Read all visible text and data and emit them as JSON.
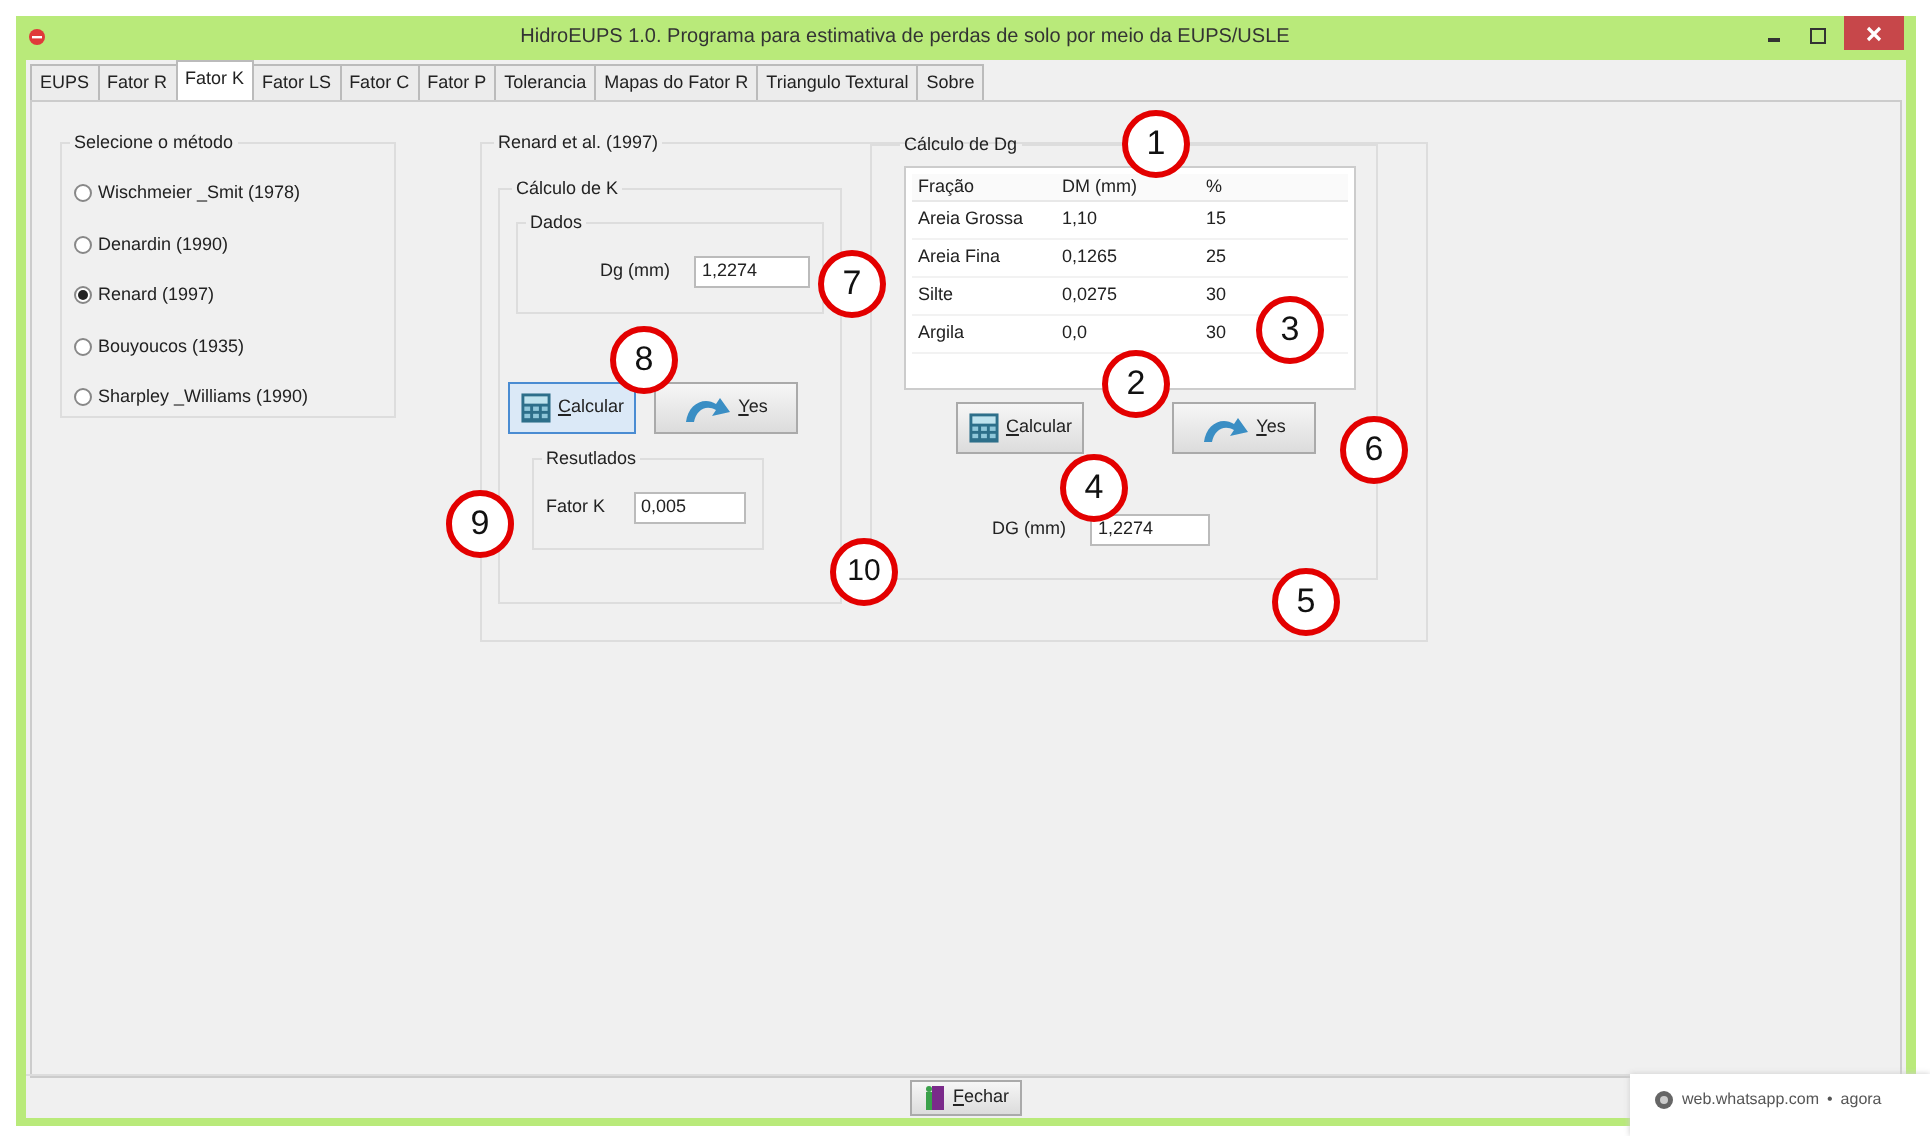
{
  "window": {
    "title": "HidroEUPS 1.0.  Programa para estimativa de perdas de solo por meio da EUPS/USLE"
  },
  "tabs": [
    {
      "label": "EUPS",
      "selected": false
    },
    {
      "label": "Fator R",
      "selected": false
    },
    {
      "label": "Fator K",
      "selected": true
    },
    {
      "label": "Fator LS",
      "selected": false
    },
    {
      "label": "Fator C",
      "selected": false
    },
    {
      "label": "Fator P",
      "selected": false
    },
    {
      "label": "Tolerancia",
      "selected": false
    },
    {
      "label": "Mapas do Fator R",
      "selected": false
    },
    {
      "label": "Triangulo Textural",
      "selected": false
    },
    {
      "label": "Sobre",
      "selected": false
    }
  ],
  "method_group": {
    "title": "Selecione o método",
    "options": [
      {
        "label": "Wischmeier _Smit (1978)",
        "selected": false
      },
      {
        "label": "Denardin (1990)",
        "selected": false
      },
      {
        "label": "Renard (1997)",
        "selected": true
      },
      {
        "label": "Bouyoucos  (1935)",
        "selected": false
      },
      {
        "label": "Sharpley _Williams (1990)",
        "selected": false
      }
    ]
  },
  "renard": {
    "title": "Renard et al.  (1997)",
    "k_calc": {
      "title": "Cálculo de K",
      "data": {
        "title": "Dados",
        "label": "Dg (mm)",
        "value": "1,2274"
      },
      "buttons": [
        {
          "kind": "calc",
          "label": "Calcular",
          "focused": true
        },
        {
          "kind": "yes",
          "label": "Yes",
          "focused": false
        }
      ],
      "results": {
        "title": "Resutlados",
        "label": "Fator K",
        "value": "0,005"
      }
    },
    "dg_calc": {
      "title": "Cálculo de Dg",
      "table": {
        "columns": [
          "Fração",
          "DM (mm)",
          "%"
        ],
        "rows": [
          [
            "Areia Grossa",
            "1,10",
            "15"
          ],
          [
            "Areia Fina",
            "0,1265",
            "25"
          ],
          [
            "Silte",
            "0,0275",
            "30"
          ],
          [
            "Argila",
            "0,0",
            "30"
          ]
        ]
      },
      "buttons": [
        {
          "kind": "calc",
          "label": "Calcular",
          "focused": false
        },
        {
          "kind": "yes",
          "label": "Yes",
          "focused": false
        }
      ],
      "dg": {
        "label": "DG (mm)",
        "value": "1,2274"
      }
    }
  },
  "callouts": [
    "1",
    "2",
    "3",
    "4",
    "5",
    "6",
    "7",
    "8",
    "9",
    "10"
  ],
  "footer": {
    "close_button": "Fechar"
  },
  "notification": {
    "source": "web.whatsapp.com",
    "separator": "•",
    "time": "agora"
  }
}
